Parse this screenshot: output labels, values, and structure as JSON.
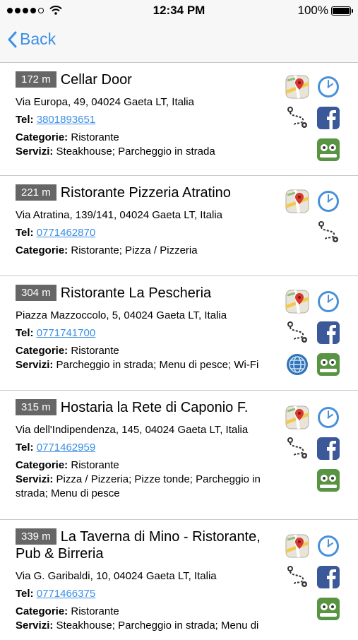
{
  "status": {
    "time": "12:34 PM",
    "battery": "100%"
  },
  "nav": {
    "back_label": "Back"
  },
  "labels": {
    "tel": "Tel:",
    "categorie": "Categorie:",
    "servizi": "Servizi:"
  },
  "items": [
    {
      "distance": "172 m",
      "name": "Cellar Door",
      "address": "Via Europa, 49, 04024 Gaeta LT, Italia",
      "phone": "3801893651",
      "categorie": "Ristorante",
      "servizi": "Steakhouse; Parcheggio in strada"
    },
    {
      "distance": "221 m",
      "name": "Ristorante Pizzeria Atratino",
      "address": "Via Atratina, 139/141, 04024 Gaeta LT, Italia",
      "phone": "0771462870",
      "categorie": "Ristorante; Pizza / Pizzeria"
    },
    {
      "distance": "304 m",
      "name": "Ristorante La Pescheria",
      "address": "Piazza Mazzoccolo, 5, 04024 Gaeta LT, Italia",
      "phone": "0771741700",
      "categorie": "Ristorante",
      "servizi": "Parcheggio in strada; Menu di pesce; Wi-Fi"
    },
    {
      "distance": "315 m",
      "name": "Hostaria la Rete di Caponio F.",
      "address": "Via dell'Indipendenza, 145, 04024 Gaeta LT, Italia",
      "phone": "0771462959",
      "categorie": "Ristorante",
      "servizi": "Pizza / Pizzeria; Pizze tonde; Parcheggio in strada; Menu di pesce"
    },
    {
      "distance": "339 m",
      "name": "La Taverna di Mino - Ristorante, Pub & Birreria",
      "address": "Via G. Garibaldi, 10, 04024 Gaeta LT, Italia",
      "phone": "0771466375",
      "categorie": "Ristorante",
      "servizi": "Steakhouse; Parcheggio in strada; Menu di"
    }
  ],
  "colors": {
    "accent": "#3b8fe6",
    "distance_badge": "#666666",
    "facebook": "#3b5998",
    "tripadvisor": "#589442"
  },
  "icons": [
    "maps-icon",
    "clock-icon",
    "route-icon",
    "facebook-icon",
    "tripadvisor-icon",
    "globe-icon"
  ]
}
